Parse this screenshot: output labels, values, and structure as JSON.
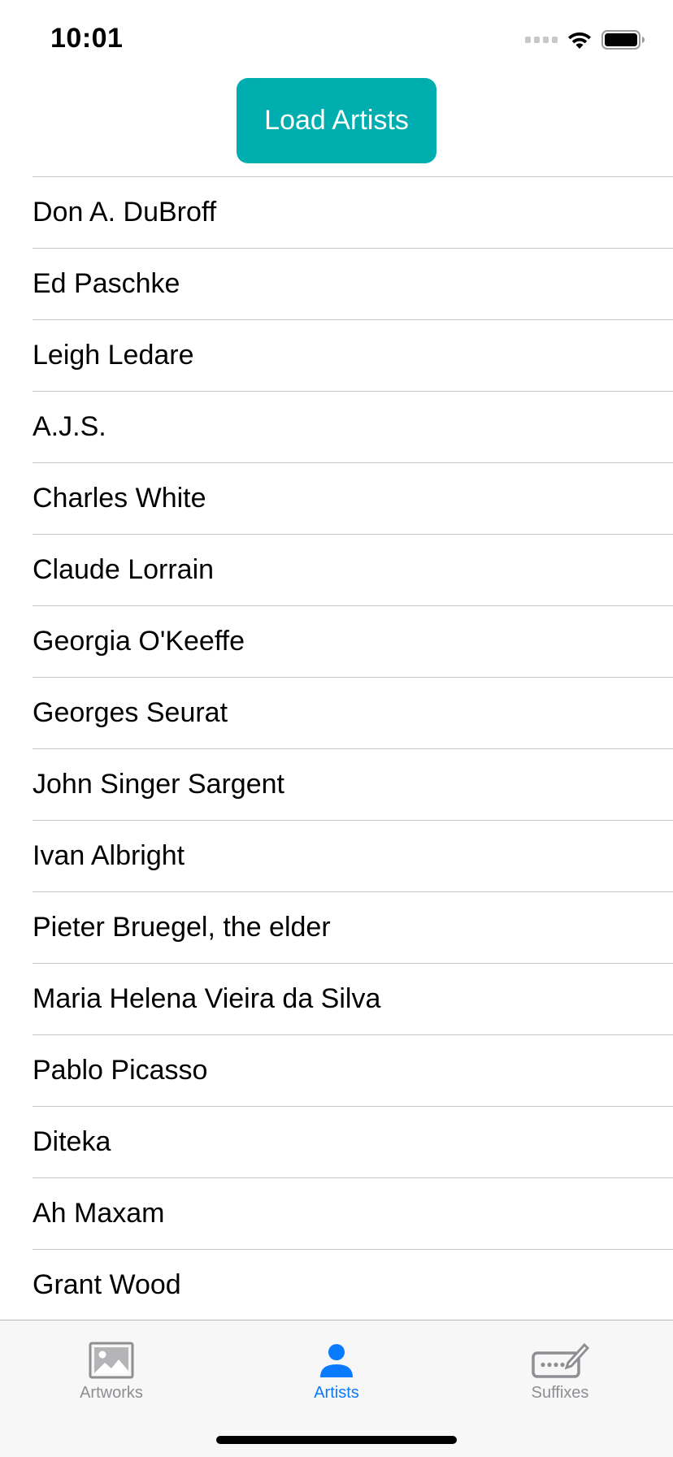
{
  "status_bar": {
    "time": "10:01",
    "icons": [
      "cellular-signal-icon",
      "wifi-icon",
      "battery-icon"
    ]
  },
  "load_button": {
    "label": "Load Artists",
    "color": "#00aeb0"
  },
  "artists": [
    "Don A. DuBroff",
    "Ed Paschke",
    "Leigh Ledare",
    "A.J.S.",
    "Charles White",
    "Claude Lorrain",
    "Georgia O'Keeffe",
    "Georges Seurat",
    "John Singer Sargent",
    "Ivan Albright",
    "Pieter Bruegel, the elder",
    "Maria Helena Vieira da Silva",
    "Pablo Picasso",
    "Diteka",
    "Ah Maxam",
    "Grant Wood"
  ],
  "tab_bar": {
    "tabs": [
      {
        "label": "Artworks",
        "icon": "photo-icon",
        "active": false
      },
      {
        "label": "Artists",
        "icon": "person-icon",
        "active": true
      },
      {
        "label": "Suffixes",
        "icon": "keyboard-edit-icon",
        "active": false
      }
    ],
    "active_color": "#0a7aff",
    "inactive_color": "#8e8e93"
  }
}
